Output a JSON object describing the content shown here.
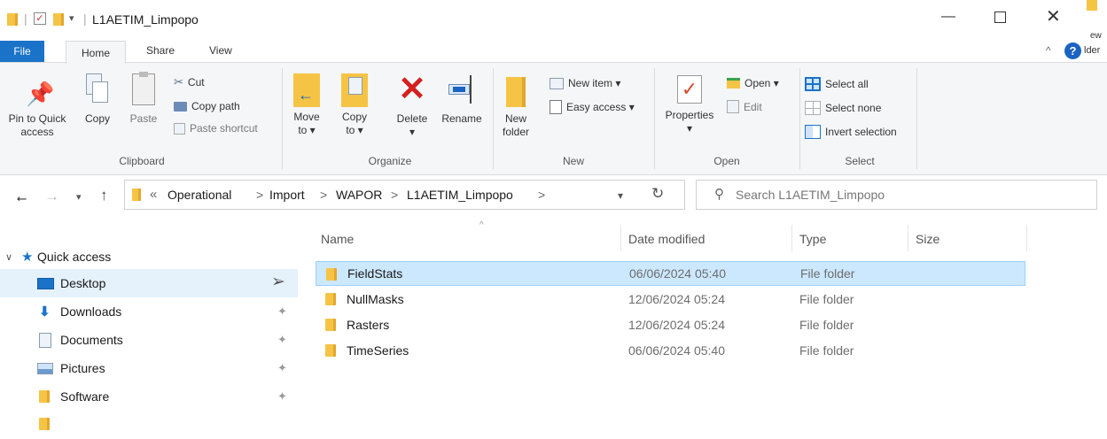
{
  "window": {
    "title": "L1AETIM_Limpopo",
    "side_text_top": "ew",
    "side_text_bottom": "lder"
  },
  "tabs": [
    {
      "label": "File"
    },
    {
      "label": "Home"
    },
    {
      "label": "Share"
    },
    {
      "label": "View"
    }
  ],
  "ribbon": {
    "clipboard": {
      "pin_label": "Pin to Quick access",
      "copy_label": "Copy",
      "paste_label": "Paste",
      "cut_label": "Cut",
      "copy_path_label": "Copy path",
      "paste_shortcut_label": "Paste shortcut",
      "group_label": "Clipboard"
    },
    "organize": {
      "move_to_label": "Move to ▾",
      "copy_to_label": "Copy to ▾",
      "delete_label": "Delete",
      "delete_arrow": "▾",
      "rename_label": "Rename",
      "group_label": "Organize"
    },
    "new": {
      "new_folder_label": "New folder",
      "new_item_label": "New item ▾",
      "easy_access_label": "Easy access ▾",
      "group_label": "New"
    },
    "open": {
      "properties_label": "Properties",
      "properties_arrow": "▾",
      "open_label": "Open ▾",
      "edit_label": "Edit",
      "group_label": "Open"
    },
    "select": {
      "select_all_label": "Select all",
      "select_none_label": "Select none",
      "invert_label": "Invert selection",
      "group_label": "Select"
    }
  },
  "address": {
    "overflow": "«",
    "crumbs": [
      "Operational",
      "Import",
      "WAPOR",
      "L1AETIM_Limpopo"
    ],
    "separator": ">",
    "search_placeholder": "Search L1AETIM_Limpopo"
  },
  "nav": {
    "quick_access_label": "Quick access",
    "items": [
      {
        "label": "Desktop"
      },
      {
        "label": "Downloads"
      },
      {
        "label": "Documents"
      },
      {
        "label": "Pictures"
      },
      {
        "label": "Software"
      }
    ]
  },
  "columns": {
    "name": "Name",
    "date": "Date modified",
    "type": "Type",
    "size": "Size"
  },
  "files": [
    {
      "name": "FieldStats",
      "date": "06/06/2024 05:40",
      "type": "File folder"
    },
    {
      "name": "NullMasks",
      "date": "12/06/2024 05:24",
      "type": "File folder"
    },
    {
      "name": "Rasters",
      "date": "12/06/2024 05:24",
      "type": "File folder"
    },
    {
      "name": "TimeSeries",
      "date": "06/06/2024 05:40",
      "type": "File folder"
    }
  ],
  "colors": {
    "accent": "#1a73c8",
    "selection": "#cce8ff",
    "selection_border": "#99d1ff",
    "folder": "#f6c445",
    "delete_red": "#d42020"
  }
}
